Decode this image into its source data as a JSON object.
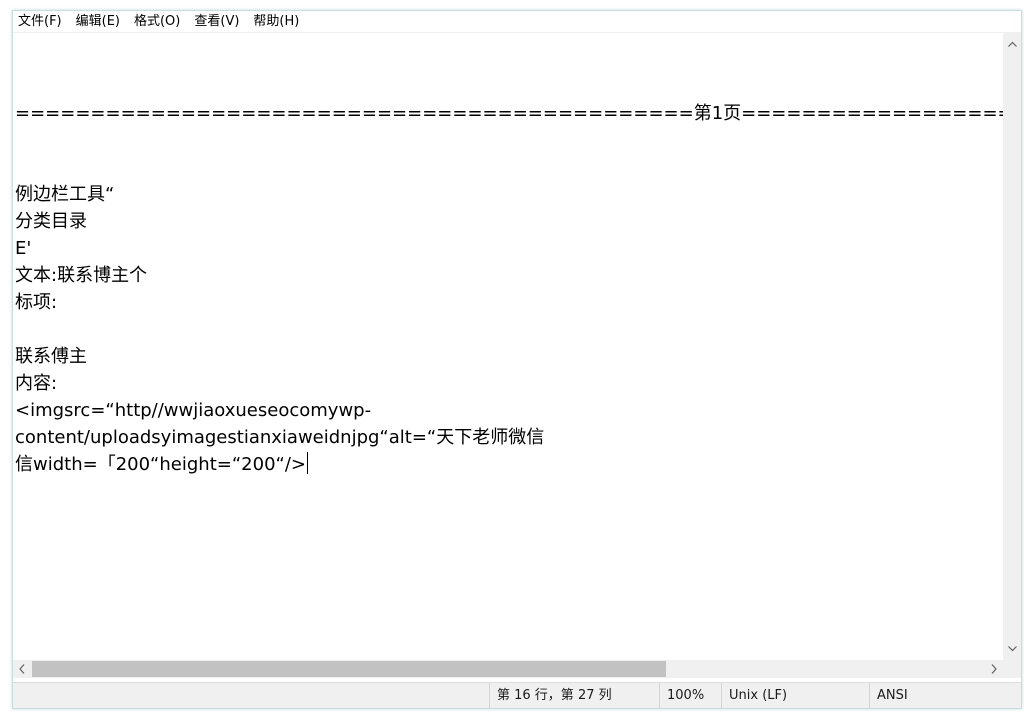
{
  "menubar": {
    "items": [
      {
        "label": "文件(F)"
      },
      {
        "label": "编辑(E)"
      },
      {
        "label": "格式(O)"
      },
      {
        "label": "查看(V)"
      },
      {
        "label": "帮助(H)"
      }
    ]
  },
  "editor": {
    "lines": [
      "",
      "",
      "=============================================第1页=====================",
      "",
      "",
      "例边栏工具“",
      "分类目录",
      "E'",
      "文本:联系博主个",
      "标项:",
      "",
      "联系傅主",
      "内容:",
      "<imgsrc=“http//wwjiaoxueseocomywp-",
      "content/uploadsyimagestianxiaweidnjpg“alt=“天下老师微信",
      "信width=「200“height=“200“/>"
    ]
  },
  "statusbar": {
    "position": "第 16 行，第 27 列",
    "zoom": "100%",
    "line_ending": "Unix (LF)",
    "encoding": "ANSI"
  },
  "colors": {
    "window_border": "#c8dde0",
    "scrollbar_track": "#f0f0f0",
    "scrollbar_thumb": "#c2c2c2",
    "status_background": "#f0f0f0"
  },
  "icons": {
    "scroll_up": "chevron-up-icon",
    "scroll_down": "chevron-down-icon",
    "scroll_left": "chevron-left-icon",
    "scroll_right": "chevron-right-icon"
  }
}
